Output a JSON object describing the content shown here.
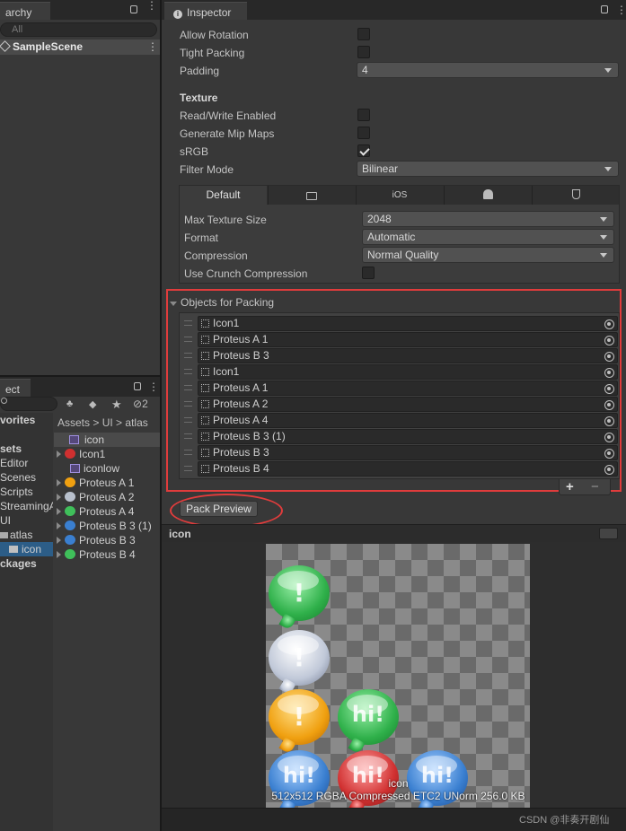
{
  "hierarchy": {
    "tab": "archy",
    "search_placeholder": "All",
    "scene": "SampleScene"
  },
  "inspector": {
    "tab": "Inspector",
    "rows": [
      {
        "label": "Allow Rotation",
        "checked": false
      },
      {
        "label": "Tight Packing",
        "checked": false
      }
    ],
    "padding_label": "Padding",
    "padding_value": "4",
    "texture_header": "Texture",
    "texture_rows": [
      {
        "label": "Read/Write Enabled",
        "checked": false
      },
      {
        "label": "Generate Mip Maps",
        "checked": false
      },
      {
        "label": "sRGB",
        "checked": true
      }
    ],
    "filter_label": "Filter Mode",
    "filter_value": "Bilinear",
    "platform_tabs": [
      "Default",
      "monitor-icon",
      "iOS",
      "android-icon",
      "html5-icon"
    ],
    "max_size_label": "Max Texture Size",
    "max_size_value": "2048",
    "format_label": "Format",
    "format_value": "Automatic",
    "compression_label": "Compression",
    "compression_value": "Normal Quality",
    "crunch_label": "Use Crunch Compression",
    "objects_header": "Objects for Packing",
    "objects": [
      "Icon1",
      "Proteus A 1",
      "Proteus B 3",
      "Icon1",
      "Proteus A 1",
      "Proteus A 2",
      "Proteus A 4",
      "Proteus B 3 (1)",
      "Proteus B 3",
      "Proteus B 4"
    ],
    "add_label": "+",
    "remove_label": "−",
    "pack_preview": "Pack Preview",
    "preview_title": "icon",
    "preview_name": "icon",
    "preview_info": "512x512 RGBA Compressed ETC2 UNorm  256.0 KB",
    "watermark": "CSDN @非奏开剧仙"
  },
  "project": {
    "tab": "ect",
    "badge": "2",
    "breadcrumb": [
      "Assets",
      "UI",
      "atlas"
    ],
    "left_tree": [
      "vorites",
      "sets",
      "Editor",
      "Scenes",
      "Scripts",
      "StreamingA",
      "UI",
      "atlas",
      "icon",
      "ckages"
    ],
    "files": [
      "icon",
      "Icon1",
      "iconlow",
      "Proteus A 1",
      "Proteus A 2",
      "Proteus A 4",
      "Proteus B 3 (1)",
      "Proteus B 3",
      "Proteus B 4"
    ]
  },
  "colors": {
    "accent_red": "#e03c3c",
    "selection": "#2c5d87",
    "green": "#3fbf5a",
    "orange": "#f0a010",
    "blue": "#3a7fd0",
    "red": "#d03030",
    "grey": "#b8c0cc"
  }
}
